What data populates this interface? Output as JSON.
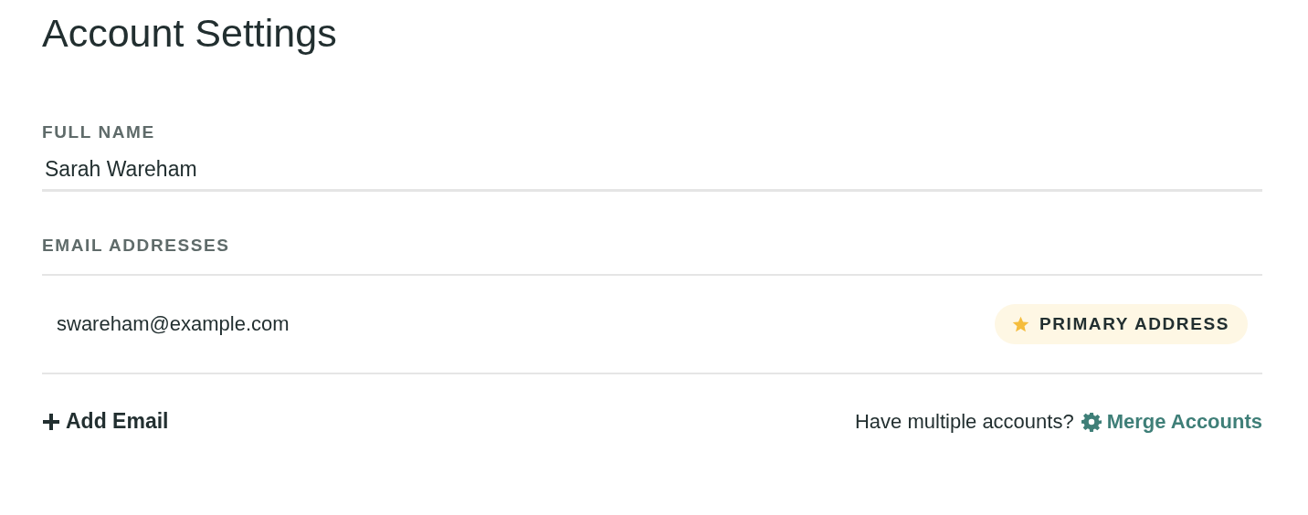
{
  "title": "Account Settings",
  "full_name": {
    "label": "FULL NAME",
    "value": "Sarah Wareham"
  },
  "email_addresses": {
    "label": "EMAIL ADDRESSES",
    "items": [
      {
        "address": "swareham@example.com",
        "primary": true,
        "badge": "PRIMARY ADDRESS"
      }
    ]
  },
  "add_email": "Add Email",
  "merge": {
    "prompt": "Have multiple accounts?",
    "link": "Merge Accounts"
  }
}
